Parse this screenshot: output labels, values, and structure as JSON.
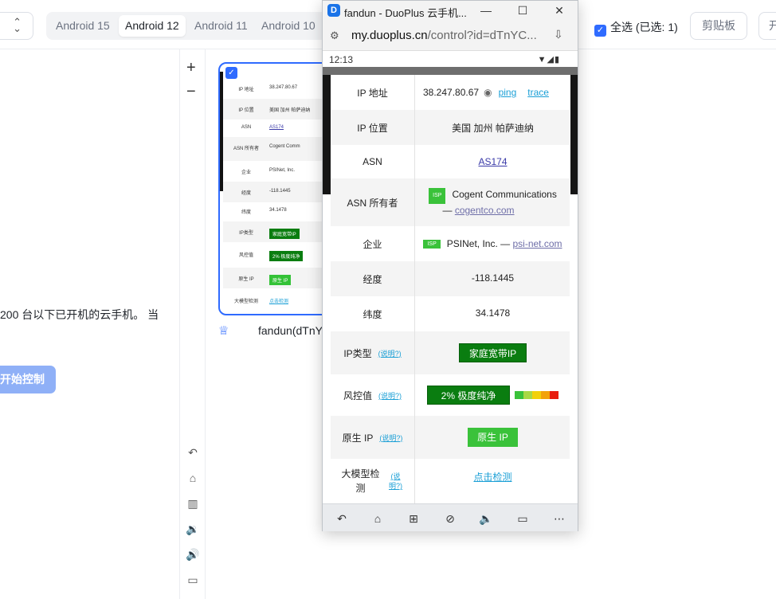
{
  "toolbar": {
    "android_tabs": [
      "Android 15",
      "Android 12",
      "Android 11",
      "Android 10"
    ],
    "active_tab": "Android 12",
    "select_all_label": "全选 (已选: 1)",
    "clipboard_label": "剪贴板",
    "truncated_button_label": "开"
  },
  "sidebar": {
    "description": "200 台以下已开机的云手机。 当",
    "start_control_label": "开始控制"
  },
  "device_card": {
    "name": "fandun(dTnY",
    "thumb_rows": [
      {
        "k": "IP 地址",
        "v": "38.247.80.67"
      },
      {
        "k": "IP 位置",
        "v": "美国 加州 帕萨迪纳"
      },
      {
        "k": "ASN",
        "v": "AS174"
      },
      {
        "k": "ASN 所有者",
        "v": "Cogent Comm"
      },
      {
        "k": "企业",
        "v": "PSINet, Inc."
      },
      {
        "k": "经度",
        "v": "-118.1445"
      },
      {
        "k": "纬度",
        "v": "34.1478"
      },
      {
        "k": "IP类型",
        "v": "家庭宽带IP"
      },
      {
        "k": "风控值",
        "v": "2%  极度纯净"
      },
      {
        "k": "原生 IP",
        "v": "原生 IP"
      },
      {
        "k": "大模型检测",
        "v": "点击检测"
      }
    ]
  },
  "window": {
    "title": "fandun - DuoPlus 云手机...",
    "url_host": "my.duoplus.cn",
    "url_path": "/control?id=dTnYC...",
    "status_time": "12:13"
  },
  "ip_table": {
    "ip_label": "IP 地址",
    "ip_value": "38.247.80.67",
    "ping_label": "ping",
    "trace_label": "trace",
    "location_label": "IP 位置",
    "location_value": "美国 加州 帕萨迪纳",
    "asn_label": "ASN",
    "asn_value": "AS174",
    "asn_owner_label": "ASN 所有者",
    "isp_badge": "ISP",
    "asn_owner_name": "Cogent Communications",
    "asn_owner_dash": "—",
    "asn_owner_domain": "cogentco.com",
    "company_label": "企业",
    "company_name": "PSINet, Inc. —",
    "company_domain": "psi-net.com",
    "longitude_label": "经度",
    "longitude_value": "-118.1445",
    "latitude_label": "纬度",
    "latitude_value": "34.1478",
    "iptype_label": "IP类型",
    "explain_label": "(说明?)",
    "iptype_value": "家庭宽带IP",
    "risk_label": "风控值",
    "risk_value": "2%   极度纯净",
    "risk_colors": [
      "#3ac23a",
      "#a8d845",
      "#f2d10a",
      "#f2a20a",
      "#e81c0e"
    ],
    "native_label": "原生 IP",
    "native_value": "原生 IP",
    "llm_label": "大模型检测",
    "llm_value": "点击检测"
  },
  "colors": {
    "accent": "#2f6bff",
    "dark_green": "#0a7d10",
    "light_green": "#3ac23a",
    "link": "#1a9fd6"
  }
}
